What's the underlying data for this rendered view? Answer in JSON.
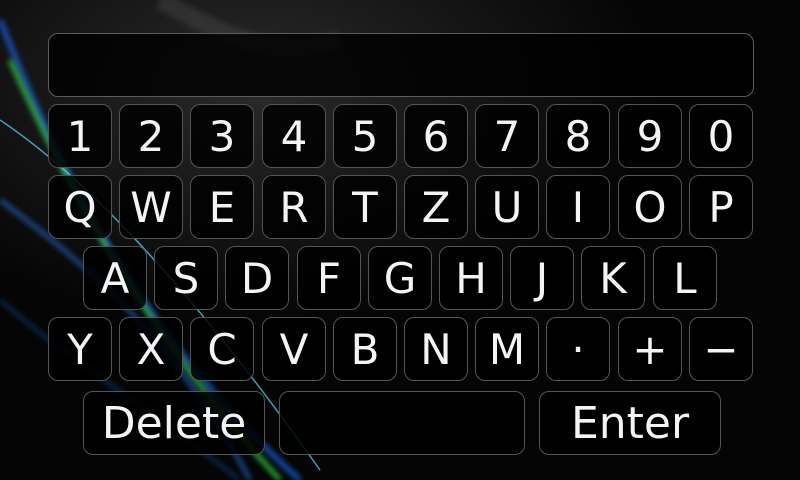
{
  "display": {
    "value": ""
  },
  "rows": {
    "numbers": [
      "1",
      "2",
      "3",
      "4",
      "5",
      "6",
      "7",
      "8",
      "9",
      "0"
    ],
    "top": [
      "Q",
      "W",
      "E",
      "R",
      "T",
      "Z",
      "U",
      "I",
      "O",
      "P"
    ],
    "home": [
      "A",
      "S",
      "D",
      "F",
      "G",
      "H",
      "J",
      "K",
      "L"
    ],
    "bottom": [
      "Y",
      "X",
      "C",
      "V",
      "B",
      "N",
      "M",
      "·",
      "+",
      "−"
    ]
  },
  "actions": {
    "delete_label": "Delete",
    "space_label": "",
    "enter_label": "Enter"
  }
}
